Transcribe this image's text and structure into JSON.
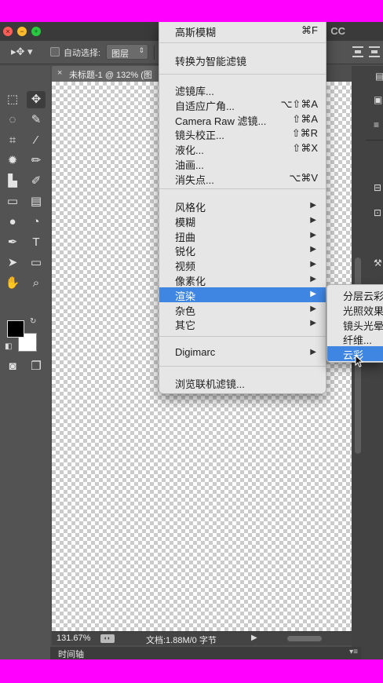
{
  "window": {
    "title_suffix": "CC"
  },
  "options_bar": {
    "tool_glyph": "▸✥ ▾",
    "auto_select_label": "自动选择:",
    "auto_select_target": "图层"
  },
  "document": {
    "tab_title": "未标题-1 @ 132% (图",
    "close_glyph": "×"
  },
  "status": {
    "zoom": "131.67%",
    "doc_size": "文档:1.88M/0 字节"
  },
  "timeline": {
    "label": "时间轴"
  },
  "filter_menu": {
    "last_filter": {
      "label": "高斯模糊",
      "shortcut": "⌘F"
    },
    "convert_smart": {
      "label": "转换为智能滤镜"
    },
    "items_a": [
      {
        "label": "滤镜库...",
        "shortcut": ""
      },
      {
        "label": "自适应广角...",
        "shortcut": "⌥⇧⌘A"
      },
      {
        "label": "Camera Raw 滤镜...",
        "shortcut": "⇧⌘A"
      },
      {
        "label": "镜头校正...",
        "shortcut": "⇧⌘R"
      },
      {
        "label": "液化...",
        "shortcut": "⇧⌘X"
      },
      {
        "label": "油画...",
        "shortcut": ""
      },
      {
        "label": "消失点...",
        "shortcut": "⌥⌘V"
      }
    ],
    "items_b": [
      {
        "label": "风格化"
      },
      {
        "label": "模糊"
      },
      {
        "label": "扭曲"
      },
      {
        "label": "锐化"
      },
      {
        "label": "视频"
      },
      {
        "label": "像素化"
      },
      {
        "label": "渲染"
      },
      {
        "label": "杂色"
      },
      {
        "label": "其它"
      }
    ],
    "highlighted": "渲染",
    "digimarc": {
      "label": "Digimarc"
    },
    "browse_online": {
      "label": "浏览联机滤镜..."
    },
    "submenu_arrow": "▶"
  },
  "render_submenu": {
    "items": [
      {
        "label": "分层云彩"
      },
      {
        "label": "光照效果..."
      },
      {
        "label": "镜头光晕..."
      },
      {
        "label": "纤维..."
      },
      {
        "label": "云彩"
      }
    ],
    "highlighted": "云彩"
  },
  "colors": {
    "highlight": "#3f86e3",
    "menu_bg": "#e6e6e6",
    "chrome": "#535353",
    "border_magenta": "#ff00ff"
  }
}
